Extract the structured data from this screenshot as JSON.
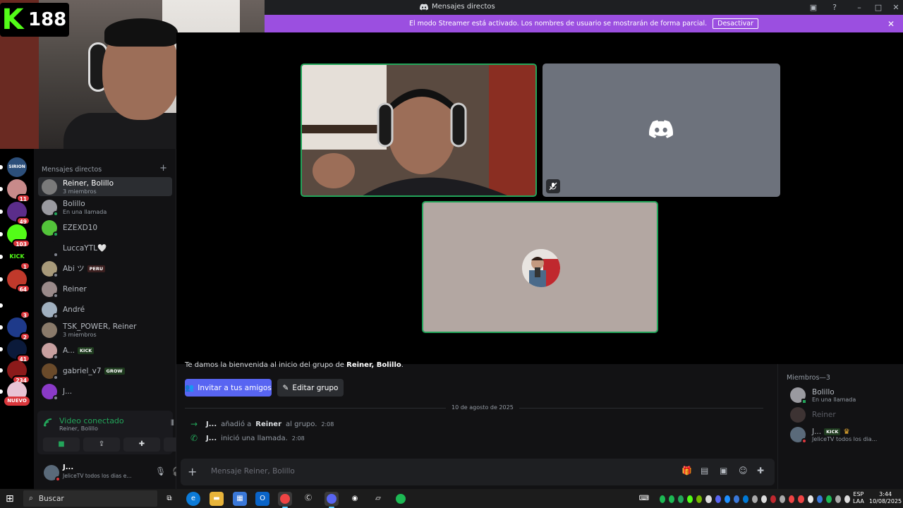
{
  "window": {
    "title": "Mensajes directos"
  },
  "banner": {
    "text": "El modo Streamer está activado. Los nombres de usuario se mostrarán de forma parcial.",
    "button": "Desactivar"
  },
  "overlay": {
    "kick_count": "188"
  },
  "servers": [
    {
      "label": "SIRION",
      "color": "#2c4f7a",
      "badge": ""
    },
    {
      "label": "",
      "color": "#c88a8a",
      "badge": "11"
    },
    {
      "label": "",
      "color": "#5b2d8a",
      "badge": "49"
    },
    {
      "label": "",
      "color": "#53fc18",
      "badge": "103"
    },
    {
      "label": "KICK",
      "color": "#000000",
      "badge": "1"
    },
    {
      "label": "",
      "color": "#c0392b",
      "badge": "64"
    },
    {
      "label": "",
      "color": "#000000",
      "badge": "3"
    },
    {
      "label": "",
      "color": "#1e3a8a",
      "badge": "2"
    },
    {
      "label": "",
      "color": "#0b1a3a",
      "badge": "41"
    },
    {
      "label": "",
      "color": "#8b1a1a",
      "badge": "234"
    },
    {
      "label": "",
      "color": "#e8c4d4",
      "badge": ""
    }
  ],
  "server_new_label": "NUEVO",
  "dm": {
    "header": "Mensajes directos",
    "items": [
      {
        "name": "Reiner, Bolillo",
        "sub": "3 miembros",
        "tag": "",
        "color": "#7a7a7a"
      },
      {
        "name": "Bolillo",
        "sub": "En una llamada",
        "tag": "",
        "color": "#9a9aa0"
      },
      {
        "name": "EZEXD10",
        "sub": "",
        "tag": "",
        "color": "#53c43a"
      },
      {
        "name": "LuccaYTL🤍",
        "sub": "",
        "tag": "",
        "color": "#121214"
      },
      {
        "name": "Abi ツ",
        "sub": "",
        "tag": "PERU",
        "color": "#a89a7a"
      },
      {
        "name": "Reiner",
        "sub": "",
        "tag": "",
        "color": "#9a8a8a"
      },
      {
        "name": "André",
        "sub": "",
        "tag": "",
        "color": "#a0b0c0"
      },
      {
        "name": "TSK_POWER, Reiner",
        "sub": "3 miembros",
        "tag": "",
        "color": "#8a7a6a"
      },
      {
        "name": "A...",
        "sub": "",
        "tag": "KICK",
        "color": "#c8a0a0"
      },
      {
        "name": "gabriel_v7",
        "sub": "",
        "tag": "GROW",
        "color": "#6a4a2a"
      },
      {
        "name": "J...",
        "sub": "",
        "tag": "",
        "color": "#8a3ac8"
      }
    ]
  },
  "voice": {
    "title": "Video conectado",
    "sub": "Reiner, Bolillo"
  },
  "user": {
    "name": "J...",
    "status": "JeliceTV todos los dias e..."
  },
  "chat": {
    "welcome_prefix": "Te damos la bienvenida al inicio del grupo de ",
    "welcome_group": "Reiner, Bolillo",
    "invite_label": "Invitar a tus amigos",
    "edit_label": "Editar grupo",
    "date_divider": "10 de agosto de 2025",
    "messages": [
      {
        "user": "J...",
        "text_a": "añadió a",
        "target": "Reiner",
        "text_b": "al grupo.",
        "time": "2:08"
      },
      {
        "user": "J...",
        "text_a": "inició una llamada.",
        "target": "",
        "text_b": "",
        "time": "2:08"
      }
    ],
    "placeholder": "Mensaje Reiner, Bolillo"
  },
  "members": {
    "header": "Miembros—3",
    "items": [
      {
        "name": "Bolillo",
        "sub": "En una llamada",
        "tag": ""
      },
      {
        "name": "Reiner",
        "sub": "",
        "tag": ""
      },
      {
        "name": "J...",
        "sub": "JeliceTV todos los dia...",
        "tag": "KICK"
      }
    ]
  },
  "taskbar": {
    "search": "Buscar",
    "lang_top": "ESP",
    "lang_bottom": "LAA",
    "time": "3:44",
    "date": "10/08/2025"
  }
}
